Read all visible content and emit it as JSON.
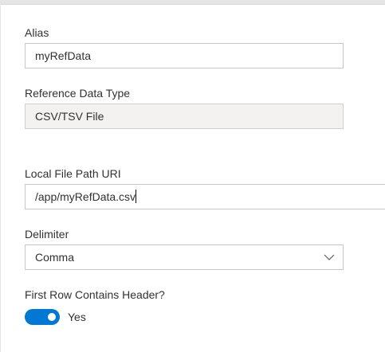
{
  "form": {
    "alias": {
      "label": "Alias",
      "value": "myRefData"
    },
    "reference_data_type": {
      "label": "Reference Data Type",
      "value": "CSV/TSV File"
    },
    "local_file_path": {
      "label": "Local File Path URI",
      "value": "/app/myRefData.csv"
    },
    "delimiter": {
      "label": "Delimiter",
      "selected": "Comma"
    },
    "first_row_header": {
      "label": "First Row Contains Header?",
      "state_text": "Yes",
      "on": true
    }
  },
  "colors": {
    "accent": "#0078d4",
    "border": "#c8c6c4",
    "disabled_bg": "#f3f2f1",
    "text": "#323130"
  },
  "icons": {
    "delimiter_dropdown": "chevron-down-icon"
  }
}
